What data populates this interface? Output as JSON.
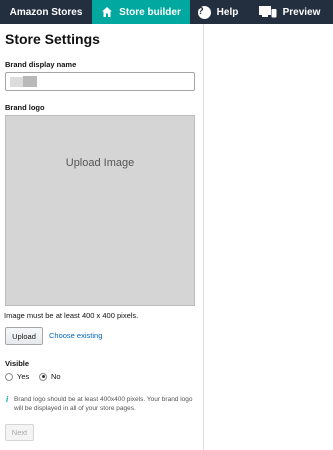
{
  "topbar": {
    "brand": "Amazon Stores",
    "builder": "Store builder",
    "help": "Help",
    "preview": "Preview"
  },
  "settings": {
    "title": "Store Settings",
    "brand_name_label": "Brand display name",
    "brand_logo_label": "Brand logo",
    "upload_placeholder": "Upload Image",
    "size_hint": "Image must be at least 400 x 400 pixels.",
    "upload_button": "Upload",
    "choose_existing": "Choose existing",
    "visible_label": "Visible",
    "visible_options": [
      "Yes",
      "No"
    ],
    "visible_selected": "No",
    "info_text": "Brand logo should be at least 400x400 pixels. Your brand logo will be displayed in all of your store pages.",
    "next_button": "Next"
  },
  "colors": {
    "topbar": "#232f3e",
    "accent": "#00a8a0",
    "link": "#0066c0"
  }
}
